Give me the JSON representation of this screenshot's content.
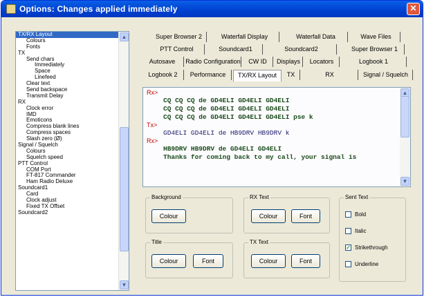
{
  "window": {
    "title": "Options: Changes applied immediately"
  },
  "tree": {
    "items": [
      {
        "label": "TX/RX Layout",
        "level": 0,
        "selected": true
      },
      {
        "label": "Colours",
        "level": 1
      },
      {
        "label": "Fonts",
        "level": 1
      },
      {
        "label": "TX",
        "level": 0
      },
      {
        "label": "Send chars",
        "level": 1
      },
      {
        "label": "Immediately",
        "level": 2
      },
      {
        "label": "Space",
        "level": 2
      },
      {
        "label": "Linefeed",
        "level": 2
      },
      {
        "label": "Clear text",
        "level": 1
      },
      {
        "label": "Send backspace",
        "level": 1
      },
      {
        "label": "Transmit Delay",
        "level": 1
      },
      {
        "label": "RX",
        "level": 0
      },
      {
        "label": "Clock error",
        "level": 1
      },
      {
        "label": "IMD",
        "level": 1
      },
      {
        "label": "Emoticons",
        "level": 1
      },
      {
        "label": "Compress blank lines",
        "level": 1
      },
      {
        "label": "Compress spaces",
        "level": 1
      },
      {
        "label": "Slash zero (Ø)",
        "level": 1
      },
      {
        "label": "Signal / Squelch",
        "level": 0
      },
      {
        "label": "Colours",
        "level": 1
      },
      {
        "label": "Squelch speed",
        "level": 1
      },
      {
        "label": "PTT Control",
        "level": 0
      },
      {
        "label": "COM Port",
        "level": 1
      },
      {
        "label": "FT-817 Commander",
        "level": 1
      },
      {
        "label": "Ham Radio Deluxe",
        "level": 1
      },
      {
        "label": "Soundcard1",
        "level": 0
      },
      {
        "label": "Card",
        "level": 1
      },
      {
        "label": "Clock adjust",
        "level": 1
      },
      {
        "label": "Fixed TX Offset",
        "level": 1
      },
      {
        "label": "Soundcard2",
        "level": 0
      }
    ]
  },
  "tabs": {
    "row1": [
      "Super Browser 2",
      "Waterfall Display",
      "Waterfall Data",
      "Wave Files"
    ],
    "row2": [
      "PTT Control",
      "Soundcard1",
      "Soundcard2",
      "Super Browser 1"
    ],
    "row3": [
      "Autosave",
      "Radio Configuration",
      "CW ID",
      "Displays",
      "Locators",
      "Logbook 1"
    ],
    "row4": [
      "Logbook 2",
      "Performance",
      "TX/RX Layout",
      "TX",
      "RX",
      "Signal / Squelch"
    ]
  },
  "text_area": {
    "lines": [
      {
        "kind": "label",
        "text": "Rx>"
      },
      {
        "kind": "green",
        "text": "CQ CQ CQ de GD4ELI GD4ELI GD4ELI"
      },
      {
        "kind": "green",
        "text": "CQ CQ CQ de GD4ELI GD4ELI GD4ELI"
      },
      {
        "kind": "green",
        "text": "CQ CQ CQ de GD4ELI GD4ELI GD4ELI pse k"
      },
      {
        "kind": "label",
        "text": "Tx>"
      },
      {
        "kind": "blue",
        "text": "GD4ELI GD4ELI de HB9DRV HB9DRV k"
      },
      {
        "kind": "label",
        "text": "Rx>"
      },
      {
        "kind": "green",
        "text": "HB9DRV HB9DRV de GD4ELI GD4ELI"
      },
      {
        "kind": "green",
        "text": "Thanks for coming back to my call, your signal is"
      }
    ]
  },
  "groups": {
    "background": {
      "title": "Background",
      "colour": "Colour"
    },
    "rx_text": {
      "title": "RX Text",
      "colour": "Colour",
      "font": "Font"
    },
    "title": {
      "title": "Title",
      "colour": "Colour",
      "font": "Font"
    },
    "tx_text": {
      "title": "TX Text",
      "colour": "Colour",
      "font": "Font"
    },
    "sent_text": {
      "title": "Sent Text",
      "options": [
        {
          "label": "Bold",
          "checked": false
        },
        {
          "label": "Italic",
          "checked": false
        },
        {
          "label": "Strikethrough",
          "checked": true
        },
        {
          "label": "Underline",
          "checked": false
        }
      ]
    }
  },
  "colors": {
    "titlebar": "#0040d0",
    "selection": "#316ac5",
    "label_red": "#c00000",
    "rx_text": "#1a4a1a",
    "tx_text": "#1a1a6a"
  }
}
